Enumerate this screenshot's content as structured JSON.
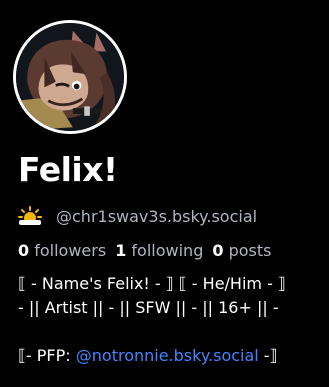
{
  "profile": {
    "display_name": "Felix!",
    "status_emoji": "sun-behind-cloud-icon",
    "handle": "@chr1swav3s.bsky.social",
    "stats": {
      "followers_count": "0",
      "followers_label": "followers",
      "following_count": "1",
      "following_label": "following",
      "posts_count": "0",
      "posts_label": "posts"
    },
    "bio": {
      "line1": "⟦ - Name's Felix! - ⟧ ⟦ - He/Him - ⟧",
      "line2": "- || Artist || - || SFW || - || 16+ || -",
      "line4_prefix": "⟦- PFP: ",
      "line4_mention": "@notronnie.bsky.social",
      "line4_suffix": " -⟧"
    }
  },
  "colors": {
    "background": "#000000",
    "text": "#ffffff",
    "muted": "#aeb6c0",
    "link": "#3f86ff"
  }
}
